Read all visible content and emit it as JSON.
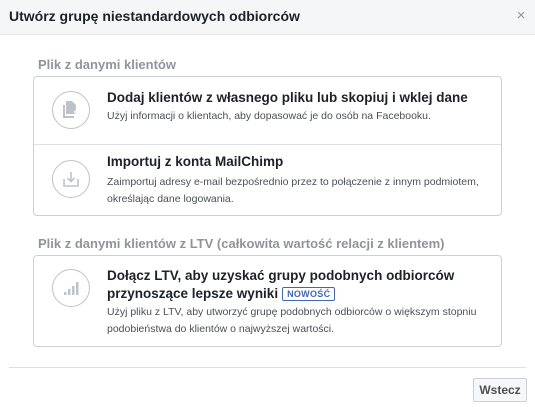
{
  "dialog": {
    "title": "Utwórz grupę niestandardowych odbiorców",
    "close_symbol": "×"
  },
  "sections": [
    {
      "title": "Plik z danymi klientów",
      "options": [
        {
          "icon": "add-file-icon",
          "title": "Dodaj klientów z własnego pliku lub skopiuj i wklej dane",
          "description": "Użyj informacji o klientach, aby dopasować je do osób na Facebooku."
        },
        {
          "icon": "import-icon",
          "title": "Importuj z konta MailChimp",
          "description": "Zaimportuj adresy e-mail bezpośrednio przez to połączenie z innym podmiotem, określając dane logowania."
        }
      ]
    },
    {
      "title": "Plik z danymi klientów z LTV (całkowita wartość relacji z klientem)",
      "options": [
        {
          "icon": "bar-chart-icon",
          "title": "Dołącz LTV, aby uzyskać grupy podobnych odbiorców przynoszące lepsze wyniki",
          "badge": "NOWOŚĆ",
          "description": "Użyj pliku z LTV, aby utworzyć grupę podobnych odbiorców o większym stopniu podobieństwa do klientów o najwyższej wartości."
        }
      ]
    }
  ],
  "footer": {
    "cancel_label": "Wstecz"
  },
  "colors": {
    "header_bg": "#f5f6f7",
    "section_title": "#90949c",
    "badge": "#4267b2",
    "icon": "#bec3c9"
  }
}
